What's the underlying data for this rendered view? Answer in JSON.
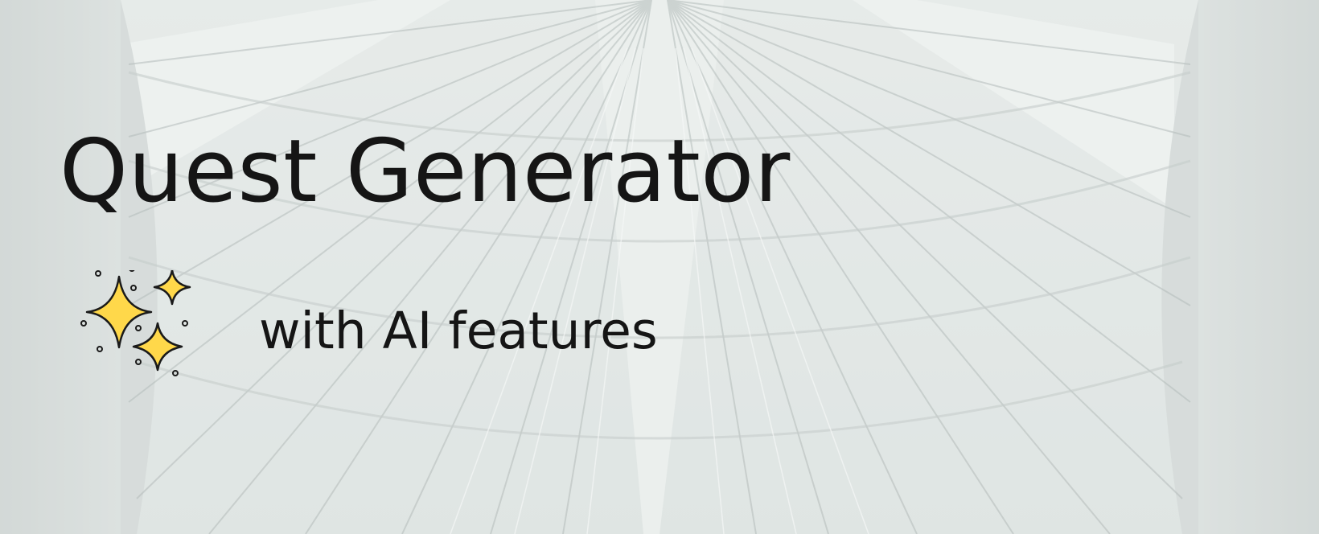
{
  "title": "Quest Generator",
  "subtitle": "with AI features",
  "icon": "sparkles-icon",
  "colors": {
    "text": "#151515",
    "sparkle_fill": "#FFD84A",
    "sparkle_outline": "#1A1A1A",
    "background": "#E1E6E5"
  }
}
